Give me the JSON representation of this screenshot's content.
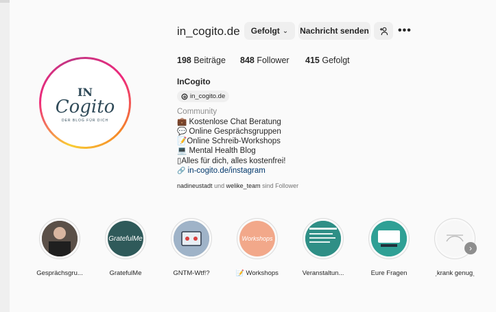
{
  "profile": {
    "username": "in_cogito.de",
    "follow_button": "Gefolgt",
    "message_button": "Nachricht senden",
    "stats": {
      "posts_count": "198",
      "posts_label": "Beiträge",
      "followers_count": "848",
      "followers_label": "Follower",
      "following_count": "415",
      "following_label": "Gefolgt"
    },
    "full_name": "InCogito",
    "threads_handle": "in_cogito.de",
    "category": "Community",
    "bio_lines": [
      "Kostenlose Chat Beratung",
      "Online Gesprächsgruppen",
      "Online Schreib-Workshops",
      "Mental Health Blog",
      "▯Alles für dich, alles kostenfrei!"
    ],
    "link": "in-cogito.de/instagram",
    "followed_by": {
      "user1": "nadineustadt",
      "and": "und",
      "user2": "welike_team",
      "suffix": "sind Follower"
    }
  },
  "logo": {
    "line1": "IN",
    "line2": "Cogito",
    "tagline": "DER BLOG FÜR DICH"
  },
  "highlights": [
    {
      "label": "Gesprächsgru...",
      "color": "#3a3a3a"
    },
    {
      "label": "GratefulMe",
      "color": "#2f5a5a",
      "cover_text": "GratefulMe"
    },
    {
      "label": "GNTM-Wtf!?",
      "color": "#7a8fa3"
    },
    {
      "label": "📝 Workshops",
      "color": "#f2a88a",
      "cover_text": "Workshops"
    },
    {
      "label": "Veranstaltun...",
      "color": "#3aa89a"
    },
    {
      "label": "Eure Fragen",
      "color": "#2fa095"
    },
    {
      "label": "ˏkrank genugˎ",
      "color": "#f3f3f3"
    }
  ],
  "colors": {
    "accent_link": "#00376b",
    "button_bg": "#efefef",
    "brand_dark": "#2f4a58"
  }
}
